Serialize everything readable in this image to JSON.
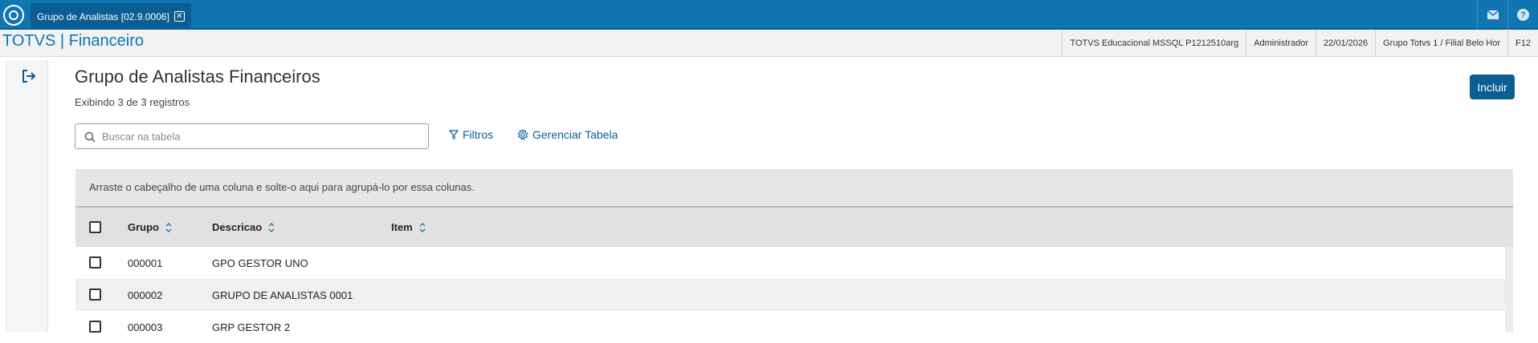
{
  "topbar": {
    "tab_label": "Grupo de Analistas [02.9.0006]",
    "icons": [
      "app-logo-icon",
      "close-icon",
      "mail-icon",
      "help-icon"
    ],
    "accent_color": "#0f75b3"
  },
  "module": {
    "title": "TOTVS | Financeiro",
    "status": [
      "TOTVS Educacional MSSQL P1212510arg",
      "Administrador",
      "22/01/2026",
      "Grupo Totvs 1 / Filial Belo Hor",
      "F12"
    ]
  },
  "page": {
    "title": "Grupo de Analistas Financeiros",
    "subtitle": "Exibindo 3 de 3 registros",
    "add_button": "Incluir",
    "search_placeholder": "Buscar na tabela",
    "filters_label": "Filtros",
    "manage_table_label": "Gerenciar Tabela"
  },
  "table": {
    "group_hint": "Arraste o cabeçalho de uma coluna e solte-o aqui para agrupá-lo por essa colunas.",
    "columns": [
      "Grupo",
      "Descricao",
      "Item"
    ],
    "rows": [
      {
        "grupo": "000001",
        "descricao": "GPO GESTOR UNO",
        "item": ""
      },
      {
        "grupo": "000002",
        "descricao": "GRUPO DE ANALISTAS 0001",
        "item": ""
      },
      {
        "grupo": "000003",
        "descricao": "GRP GESTOR 2",
        "item": ""
      }
    ]
  }
}
